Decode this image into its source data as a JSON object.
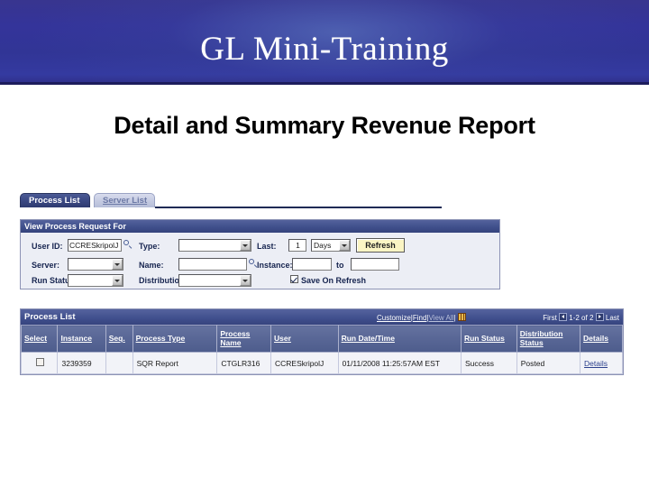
{
  "slide": {
    "banner_title": "GL Mini-Training",
    "subtitle": "Detail and Summary Revenue Report",
    "banner_color": "#34349a",
    "accent_color": "#41508e"
  },
  "screenshot": {
    "tabs": [
      {
        "label": "Process List",
        "active": true
      },
      {
        "label": "Server List",
        "active": false,
        "accesskey": "S"
      }
    ],
    "filter_panel": {
      "header": "View Process Request For",
      "fields": {
        "user_id_label": "User ID:",
        "user_id_value": "CCRESkripolJ",
        "server_label": "Server:",
        "server_value": "",
        "run_status_label": "Run Status:",
        "run_status_value": "",
        "type_label": "Type:",
        "type_value": "",
        "name_label": "Name:",
        "name_value": "",
        "distribution_status_label": "Distribution Status",
        "distribution_status_value": "",
        "last_label": "Last:",
        "last_value": "1",
        "last_unit_value": "Days",
        "instance_label": "Instance:",
        "instance_from_value": "",
        "instance_to_label": "to",
        "instance_to_value": "",
        "refresh_label": "Refresh",
        "save_on_refresh_label": "Save On Refresh",
        "save_on_refresh_checked": true
      }
    },
    "grid": {
      "title": "Process List",
      "tools": {
        "customize": "Customize",
        "find": "Find",
        "view_all": "View All",
        "grid_icon": "grid-icon",
        "separator": "|"
      },
      "pager": {
        "first": "First",
        "range": "1-2 of 2",
        "last": "Last",
        "prev_icon": "previous-page-icon",
        "next_icon": "next-page-icon"
      },
      "columns": [
        "Select",
        "Instance",
        "Seq.",
        "Process Type",
        "Process Name",
        "User",
        "Run Date/Time",
        "Run Status",
        "Distribution Status",
        "Details"
      ],
      "rows": [
        {
          "select": false,
          "instance": "3239359",
          "seq": "",
          "process_type": "SQR Report",
          "process_name": "CTGLR316",
          "user": "CCRESkripolJ",
          "run_datetime": "01/11/2008 11:25:57AM EST",
          "run_status": "Success",
          "distribution_status": "Posted",
          "details": "Details"
        }
      ]
    }
  }
}
